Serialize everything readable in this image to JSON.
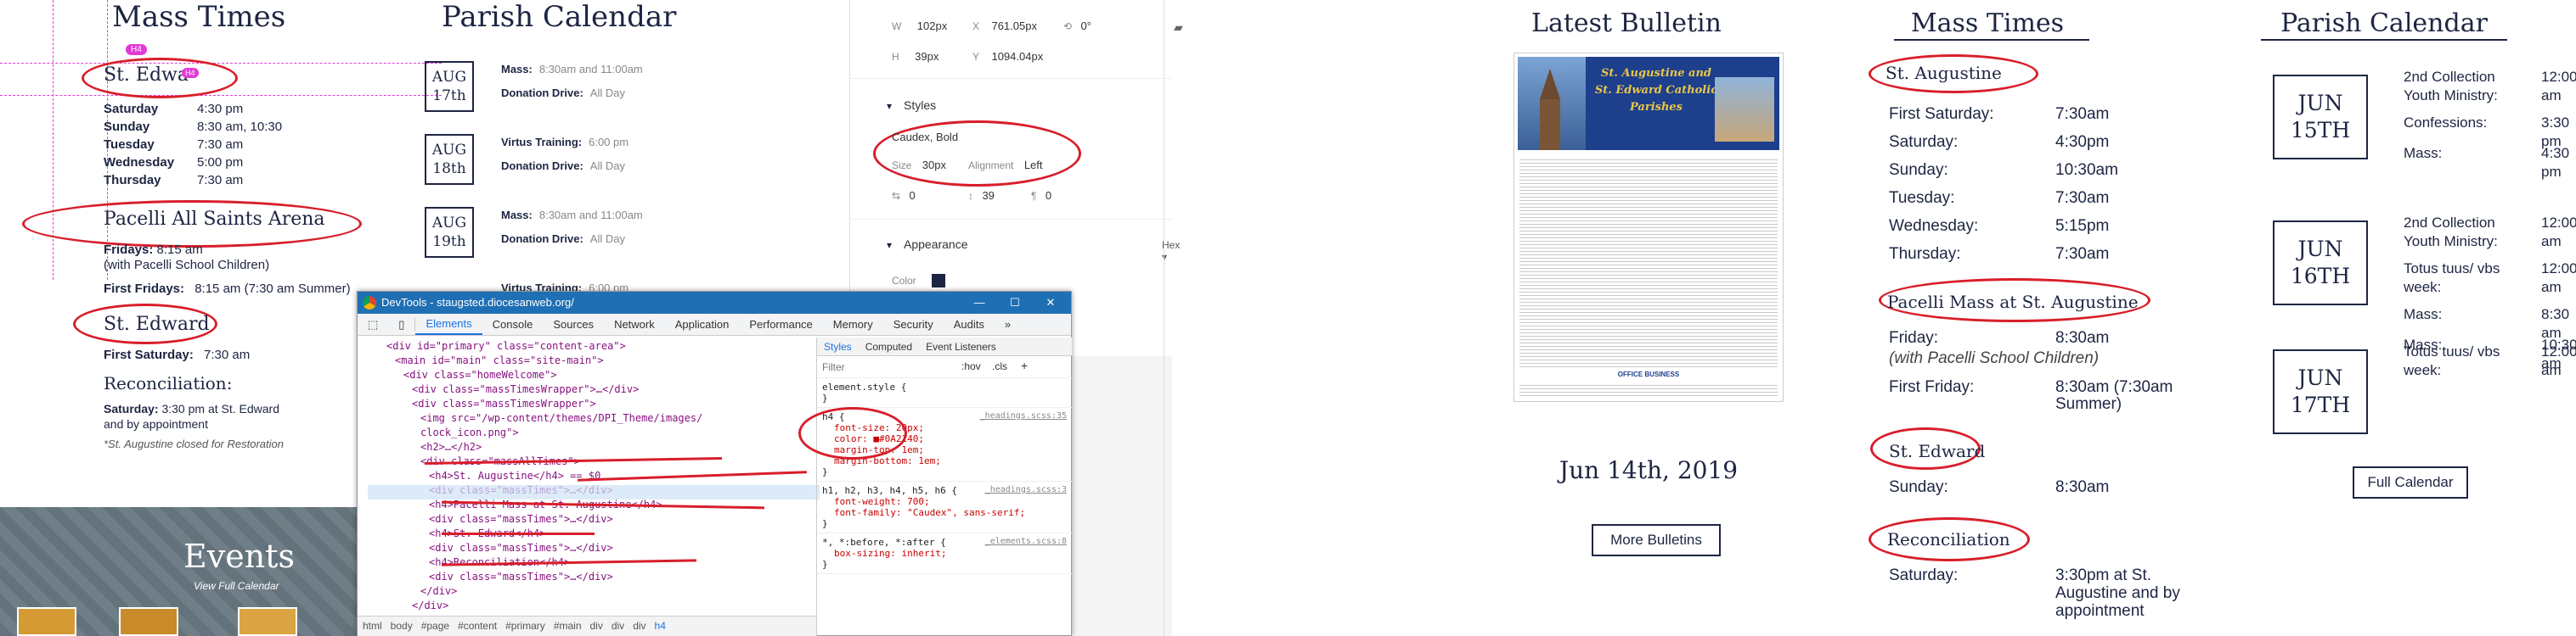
{
  "left": {
    "mass_title": "Mass Times",
    "calendar_title": "Parish Calendar",
    "badge_top": "H4",
    "badge_inline": "H4",
    "st_edward_heading": "St. Edwa",
    "edward_schedule": [
      {
        "day": "Saturday",
        "time": "4:30 pm"
      },
      {
        "day": "Sunday",
        "time": "8:30 am, 10:30"
      },
      {
        "day": "Tuesday",
        "time": "7:30 am"
      },
      {
        "day": "Wednesday",
        "time": "5:00 pm"
      },
      {
        "day": "Thursday",
        "time": "7:30 am"
      }
    ],
    "pacelli_heading": "Pacelli All Saints Arena",
    "pacelli_fridays_label": "Fridays:",
    "pacelli_fridays_time": "8:15 am",
    "pacelli_note": "(with Pacelli School Children)",
    "first_fridays_label": "First Fridays:",
    "first_fridays_time": "8:15 am (7:30 am Summer)",
    "st_edward2_heading": "St. Edward",
    "first_saturday_label": "First Saturday:",
    "first_saturday_time": "7:30 am",
    "reconciliation_heading": "Reconciliation:",
    "recon_saturday_label": "Saturday:",
    "recon_saturday_text": "3:30 pm at St. Edward",
    "recon_note": "and by appointment",
    "closed_note": "*St. Augustine closed for Restoration",
    "events_title": "Events",
    "view_calendar": "View Full Calendar",
    "calendar_days": [
      {
        "month": "AUG",
        "day": "17th",
        "events": [
          {
            "name": "Mass:",
            "time": "8:30am and 11:00am"
          },
          {
            "name": "Donation Drive:",
            "time": "All Day"
          }
        ]
      },
      {
        "month": "AUG",
        "day": "18th",
        "events": [
          {
            "name": "Virtus Training:",
            "time": "6:00 pm"
          },
          {
            "name": "Donation Drive:",
            "time": "All Day"
          }
        ]
      },
      {
        "month": "AUG",
        "day": "19th",
        "events": [
          {
            "name": "Mass:",
            "time": "8:30am and 11:00am"
          },
          {
            "name": "Donation Drive:",
            "time": "All Day"
          }
        ]
      },
      {
        "month": "",
        "day": "",
        "events": [
          {
            "name": "Virtus Training:",
            "time": "6:00 pm"
          }
        ]
      }
    ]
  },
  "design": {
    "w_label": "W",
    "w_val": "102px",
    "x_label": "X",
    "x_val": "761.05px",
    "rot_val": "0°",
    "h_label": "H",
    "h_val": "39px",
    "y_label": "Y",
    "y_val": "1094.04px",
    "styles_label": "Styles",
    "font_name": "Caudex, Bold",
    "size_label": "Size",
    "size_val": "30px",
    "align_label": "Alignment",
    "align_val": "Left",
    "spacing1": "0",
    "spacing2": "39",
    "spacing3": "0",
    "appearance_label": "Appearance",
    "hex_label": "Hex",
    "color_label": "Color",
    "color_hex": "#1d2542"
  },
  "devtools": {
    "title": "DevTools - staugsted.diocesanweb.org/",
    "tabs": [
      "Elements",
      "Console",
      "Sources",
      "Network",
      "Application",
      "Performance",
      "Memory",
      "Security",
      "Audits"
    ],
    "code": [
      {
        "indent": 2,
        "text": "<div id=\"primary\" class=\"content-area\">"
      },
      {
        "indent": 3,
        "text": "<main id=\"main\" class=\"site-main\">"
      },
      {
        "indent": 4,
        "text": "<div class=\"homeWelcome\">"
      },
      {
        "indent": 5,
        "text": "<div class=\"massTimesWrapper\">…</div>"
      },
      {
        "indent": 5,
        "text": "<div class=\"massTimesWrapper\">"
      },
      {
        "indent": 6,
        "text": "<img src=\"/wp-content/themes/DPI_Theme/images/"
      },
      {
        "indent": 6,
        "text": "clock_icon.png\">"
      },
      {
        "indent": 6,
        "text": "<h2>…</h2>"
      },
      {
        "indent": 6,
        "text": "<div class=\"massAllTimes\">"
      },
      {
        "indent": 7,
        "text": "<h4>St. Augustine</h4> == $0"
      },
      {
        "indent": 7,
        "text": "<div class=\"massTimes\">…</div>"
      },
      {
        "indent": 7,
        "text": "<h4>Pacelli Mass at St. Augustine</h4>"
      },
      {
        "indent": 7,
        "text": "<div class=\"massTimes\">…</div>"
      },
      {
        "indent": 7,
        "text": "<h4>St. Edward</h4>"
      },
      {
        "indent": 7,
        "text": "<div class=\"massTimes\">…</div>"
      },
      {
        "indent": 7,
        "text": "<h4>Reconciliation</h4>"
      },
      {
        "indent": 7,
        "text": "<div class=\"massTimes\">…</div>"
      },
      {
        "indent": 6,
        "text": "</div>"
      },
      {
        "indent": 5,
        "text": "</div>"
      }
    ],
    "breadcrumb": [
      "html",
      "body",
      "#page",
      "#content",
      "#primary",
      "#main",
      "div",
      "div",
      "div",
      "h4"
    ],
    "styles_tabs": [
      "Styles",
      "Computed",
      "Event Listeners"
    ],
    "filter_placeholder": "Filter",
    "hov": ":hov",
    "cls": ".cls",
    "plus": "+",
    "rules": [
      {
        "selector": "element.style {",
        "props": [],
        "source": ""
      },
      {
        "selector": "h4 {",
        "props": [
          "font-size: 20px;",
          "color: ■#0A2140;",
          "margin-top: 1em;",
          "margin-bottom: 1em;"
        ],
        "source": "_headings.scss:35"
      },
      {
        "selector": "h1, h2, h3, h4, h5, h6 {",
        "props": [
          "font-weight: 700;",
          "font-family: \"Caudex\", sans-serif;"
        ],
        "source": "_headings.scss:3"
      },
      {
        "selector": "*, *:before, *:after {",
        "props": [
          "box-sizing: inherit;"
        ],
        "source": "_elements.scss:8"
      }
    ]
  },
  "right": {
    "bulletin_title": "Latest Bulletin",
    "bulletin_heading": "St. Augustine and St. Edward Catholic Parishes",
    "bulletin_date": "Jun 14th, 2019",
    "bulletin_footer": "OFFICE BUSINESS",
    "more_bulletins": "More Bulletins",
    "mass_title": "Mass Times",
    "st_augustine": "St. Augustine",
    "aug_schedule": [
      {
        "day": "First Saturday:",
        "time": "7:30am"
      },
      {
        "day": "Saturday:",
        "time": "4:30pm"
      },
      {
        "day": "Sunday:",
        "time": "10:30am"
      },
      {
        "day": "Tuesday:",
        "time": "7:30am"
      },
      {
        "day": "Wednesday:",
        "time": "5:15pm"
      },
      {
        "day": "Thursday:",
        "time": "7:30am"
      }
    ],
    "pacelli_heading": "Pacelli Mass at St. Augustine",
    "friday_label": "Friday:",
    "friday_time": "8:30am",
    "pacelli_note": "(with Pacelli School Children)",
    "first_friday_label": "First Friday:",
    "first_friday_time": "8:30am (7:30am",
    "first_friday_time2": "Summer)",
    "st_edward": "St. Edward",
    "sunday_label": "Sunday:",
    "sunday_time": "8:30am",
    "reconciliation": "Reconciliation",
    "recon_saturday_label": "Saturday:",
    "recon_line1": "3:30pm at St.",
    "recon_line2": "Augustine and by",
    "recon_line3": "appointment",
    "calendar_title": "Parish Calendar",
    "calendar_days": [
      {
        "month": "JUN",
        "day": "15TH",
        "events": [
          {
            "name": "2nd Collection Youth Ministry:",
            "time": "12:00 am"
          },
          {
            "name": "Confessions:",
            "time": "3:30 pm"
          },
          {
            "name": "Mass:",
            "time": "4:30 pm"
          }
        ]
      },
      {
        "month": "JUN",
        "day": "16TH",
        "events": [
          {
            "name": "2nd Collection Youth Ministry:",
            "time": "12:00 am"
          },
          {
            "name": "Totus tuus/ vbs week:",
            "time": "12:00 am"
          },
          {
            "name": "Mass:",
            "time": "8:30 am"
          },
          {
            "name": "Mass:",
            "time": "10:30 am"
          }
        ]
      },
      {
        "month": "JUN",
        "day": "17TH",
        "events": [
          {
            "name": "Totus tuus/ vbs week:",
            "time": "12:00 am"
          }
        ]
      }
    ],
    "full_calendar": "Full Calendar"
  }
}
